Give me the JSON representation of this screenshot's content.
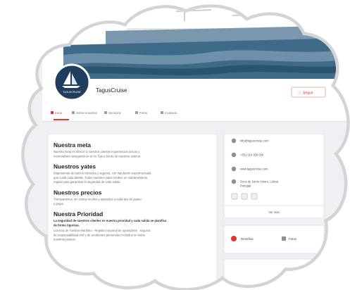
{
  "page": {
    "title": "TagusCruise",
    "logo_text": "TAGUSCRUISE",
    "follow_label": "Seguir"
  },
  "nav": {
    "items": [
      {
        "label": "Inicio",
        "icon": "home-icon"
      },
      {
        "label": "Sobre nosotros",
        "icon": "info-icon"
      },
      {
        "label": "Servicios",
        "icon": "grid-icon"
      },
      {
        "label": "Fotos",
        "icon": "camera-icon"
      },
      {
        "label": "Contacto",
        "icon": "mail-icon"
      }
    ]
  },
  "about": {
    "sections": [
      {
        "heading": "Nuestra meta",
        "lines": [
          "Nuestra meta es ofrecer a nuestros clientes experiencias únicas y",
          "memorables navegando en el río Tajo a bordo de nuestros veleros."
        ]
      },
      {
        "heading": "Nuestros yates",
        "lines": [
          "Disponemos de barcos cómodos y seguros, con tripulación experimentada",
          "que cuida cada detalle. Todos nuestros yates reciben un mantenimiento",
          "regular para garantizar la seguridad de cada salida."
        ]
      },
      {
        "heading": "Nuestros precios",
        "lines": [
          "Transparentes, sin costes ocultos y ajustados a cada tipo de paseo",
          "y grupo."
        ]
      },
      {
        "heading": "Nuestra Prioridad",
        "bold_line": "La seguridad de nuestros clientes es nuestra prioridad y cada salida se planifica",
        "bold_line2": "de forma rigurosa.",
        "lines": [
          "Licencia de Turismo Marítimo · Registro nacional de operadores · seguros",
          "de responsabilidad civil y de accidentes personales incluidos en todos",
          "nuestros paseos."
        ]
      }
    ]
  },
  "contact": {
    "items": [
      {
        "icon": "mail-icon",
        "text": "info@taguscruise.com"
      },
      {
        "icon": "phone-icon",
        "text": "+351 910 000 000"
      },
      {
        "icon": "globe-icon",
        "text": "www.taguscruise.com"
      },
      {
        "icon": "pin-icon",
        "text": "Doca de Santo Amaro, Lisboa",
        "text2": "Portugal"
      }
    ],
    "social_icons": [
      "facebook-icon",
      "instagram-icon",
      "tripadvisor-icon"
    ],
    "more_label": "Ver más"
  },
  "bottom_card": {
    "left_label": "Reseñas",
    "right_label": "Fotos"
  },
  "colors": {
    "accent": "#e3342f",
    "logo_bg": "#1f3d5c",
    "frame": "#d4d4d4",
    "page_bg": "#eef0f3",
    "cover_sea": "#3f6b8a"
  }
}
